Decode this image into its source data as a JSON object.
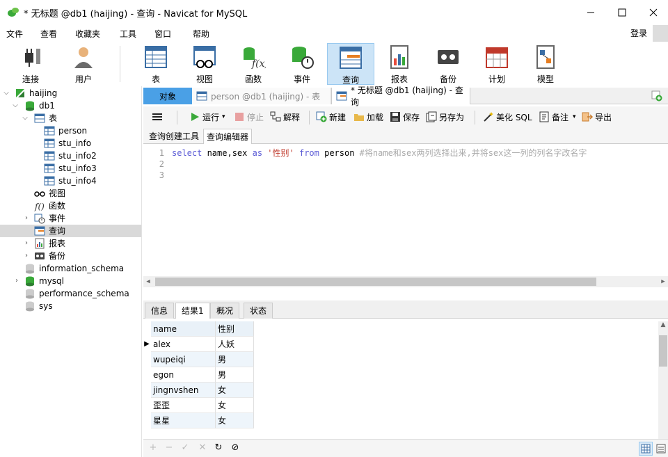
{
  "window": {
    "title": "* 无标题 @db1 (haijing) - 查询 - Navicat for MySQL"
  },
  "menu": {
    "items": [
      "文件",
      "查看",
      "收藏夹",
      "工具",
      "窗口",
      "帮助"
    ],
    "login": "登录"
  },
  "toolbar": {
    "items": [
      {
        "label": "连接",
        "icon": "plug-icon"
      },
      {
        "label": "用户",
        "icon": "user-icon"
      },
      {
        "label": "表",
        "icon": "table-icon"
      },
      {
        "label": "视图",
        "icon": "view-icon"
      },
      {
        "label": "函数",
        "icon": "function-icon"
      },
      {
        "label": "事件",
        "icon": "event-icon"
      },
      {
        "label": "查询",
        "icon": "query-icon",
        "active": true
      },
      {
        "label": "报表",
        "icon": "report-icon"
      },
      {
        "label": "备份",
        "icon": "backup-icon"
      },
      {
        "label": "计划",
        "icon": "schedule-icon"
      },
      {
        "label": "模型",
        "icon": "model-icon"
      }
    ]
  },
  "sidebar": {
    "connection": "haijing",
    "db": "db1",
    "tables_group": "表",
    "tables": [
      "person",
      "stu_info",
      "stu_info2",
      "stu_info3",
      "stu_info4"
    ],
    "views": "视图",
    "functions": "函数",
    "events": "事件",
    "queries": "查询",
    "reports": "报表",
    "backups": "备份",
    "other_dbs": [
      "information_schema",
      "mysql",
      "performance_schema",
      "sys"
    ]
  },
  "tabs": {
    "objects": "对象",
    "tab1": "person @db1 (haijing) - 表",
    "tab2": "* 无标题 @db1 (haijing) - 查询"
  },
  "query_toolbar": {
    "run": "运行",
    "stop": "停止",
    "explain": "解释",
    "new": "新建",
    "load": "加载",
    "save": "保存",
    "save_as": "另存为",
    "beautify": "美化 SQL",
    "comment": "备注",
    "export": "导出"
  },
  "subtabs": {
    "builder": "查询创建工具",
    "editor": "查询编辑器"
  },
  "editor": {
    "line_numbers": [
      "1",
      "2",
      "3"
    ],
    "kw_select": "select",
    "cols": " name,sex ",
    "kw_as": "as",
    "alias": " '性别' ",
    "kw_from": "from",
    "table": " person ",
    "comment": "#将name和sex两列选择出来,并将sex这一列的列名字改名字"
  },
  "result_tabs": [
    "信息",
    "结果1",
    "概况",
    "状态"
  ],
  "result": {
    "columns": [
      "name",
      "性别"
    ],
    "rows": [
      [
        "alex",
        "人妖"
      ],
      [
        "wupeiqi",
        "男"
      ],
      [
        "egon",
        "男"
      ],
      [
        "jingnvshen",
        "女"
      ],
      [
        "歪歪",
        "女"
      ],
      [
        "星星",
        "女"
      ]
    ]
  },
  "colors": {
    "accent": "#4aa0e6",
    "selected_tab_bg": "#cce4f7",
    "db_green": "#2e9a3a"
  }
}
